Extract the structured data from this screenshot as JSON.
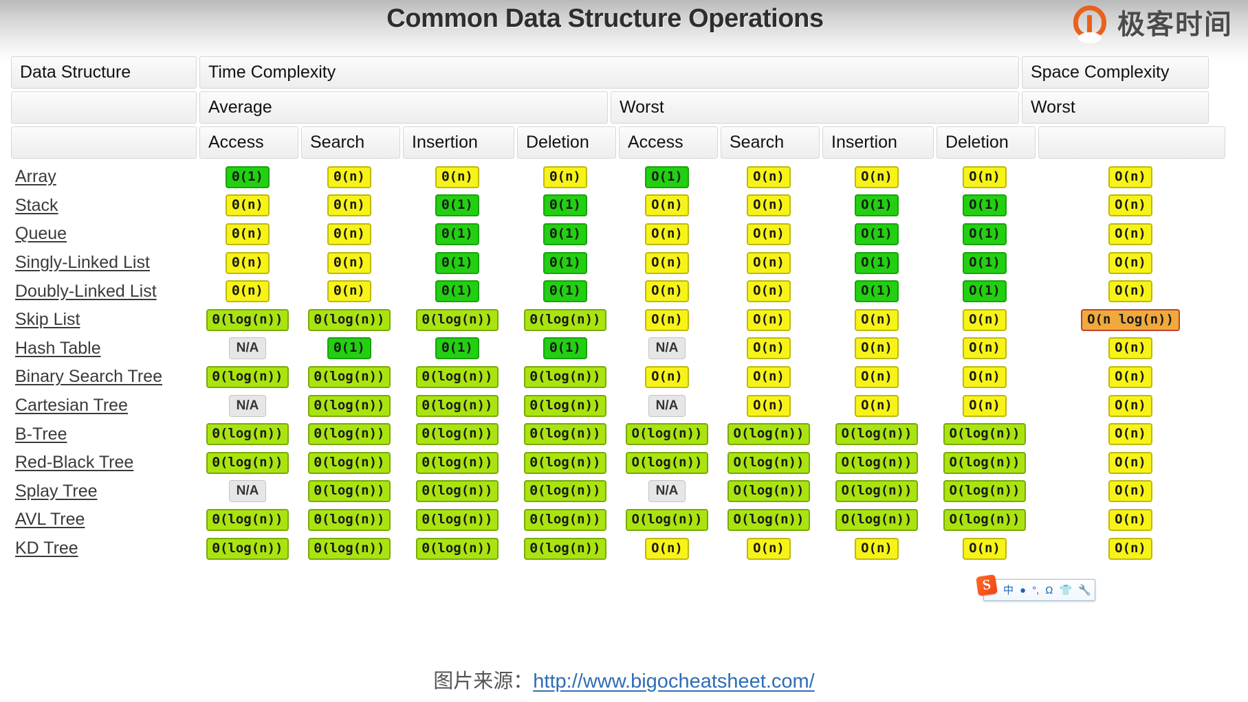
{
  "title": "Common Data Structure Operations",
  "brand": {
    "text": "极客时间",
    "mark": "geektime-logo-icon"
  },
  "table": {
    "header_row1": {
      "data_structure": "Data Structure",
      "time_complexity": "Time Complexity",
      "space_complexity": "Space Complexity"
    },
    "header_row2": {
      "average": "Average",
      "worst": "Worst",
      "space_worst": "Worst"
    },
    "header_row3": {
      "avg_access": "Access",
      "avg_search": "Search",
      "avg_insertion": "Insertion",
      "avg_deletion": "Deletion",
      "worst_access": "Access",
      "worst_search": "Search",
      "worst_insertion": "Insertion",
      "worst_deletion": "Deletion"
    },
    "rows": [
      {
        "name": "Array",
        "cells": [
          {
            "t": "Θ(1)",
            "c": "green"
          },
          {
            "t": "Θ(n)",
            "c": "yellow"
          },
          {
            "t": "Θ(n)",
            "c": "yellow"
          },
          {
            "t": "Θ(n)",
            "c": "yellow"
          },
          {
            "t": "O(1)",
            "c": "green"
          },
          {
            "t": "O(n)",
            "c": "yellow"
          },
          {
            "t": "O(n)",
            "c": "yellow"
          },
          {
            "t": "O(n)",
            "c": "yellow"
          },
          {
            "t": "O(n)",
            "c": "yellow"
          }
        ]
      },
      {
        "name": "Stack",
        "cells": [
          {
            "t": "Θ(n)",
            "c": "yellow"
          },
          {
            "t": "Θ(n)",
            "c": "yellow"
          },
          {
            "t": "Θ(1)",
            "c": "green"
          },
          {
            "t": "Θ(1)",
            "c": "green"
          },
          {
            "t": "O(n)",
            "c": "yellow"
          },
          {
            "t": "O(n)",
            "c": "yellow"
          },
          {
            "t": "O(1)",
            "c": "green"
          },
          {
            "t": "O(1)",
            "c": "green"
          },
          {
            "t": "O(n)",
            "c": "yellow"
          }
        ]
      },
      {
        "name": "Queue",
        "cells": [
          {
            "t": "Θ(n)",
            "c": "yellow"
          },
          {
            "t": "Θ(n)",
            "c": "yellow"
          },
          {
            "t": "Θ(1)",
            "c": "green"
          },
          {
            "t": "Θ(1)",
            "c": "green"
          },
          {
            "t": "O(n)",
            "c": "yellow"
          },
          {
            "t": "O(n)",
            "c": "yellow"
          },
          {
            "t": "O(1)",
            "c": "green"
          },
          {
            "t": "O(1)",
            "c": "green"
          },
          {
            "t": "O(n)",
            "c": "yellow"
          }
        ]
      },
      {
        "name": "Singly-Linked List",
        "cells": [
          {
            "t": "Θ(n)",
            "c": "yellow"
          },
          {
            "t": "Θ(n)",
            "c": "yellow"
          },
          {
            "t": "Θ(1)",
            "c": "green"
          },
          {
            "t": "Θ(1)",
            "c": "green"
          },
          {
            "t": "O(n)",
            "c": "yellow"
          },
          {
            "t": "O(n)",
            "c": "yellow"
          },
          {
            "t": "O(1)",
            "c": "green"
          },
          {
            "t": "O(1)",
            "c": "green"
          },
          {
            "t": "O(n)",
            "c": "yellow"
          }
        ]
      },
      {
        "name": "Doubly-Linked List",
        "cells": [
          {
            "t": "Θ(n)",
            "c": "yellow"
          },
          {
            "t": "Θ(n)",
            "c": "yellow"
          },
          {
            "t": "Θ(1)",
            "c": "green"
          },
          {
            "t": "Θ(1)",
            "c": "green"
          },
          {
            "t": "O(n)",
            "c": "yellow"
          },
          {
            "t": "O(n)",
            "c": "yellow"
          },
          {
            "t": "O(1)",
            "c": "green"
          },
          {
            "t": "O(1)",
            "c": "green"
          },
          {
            "t": "O(n)",
            "c": "yellow"
          }
        ]
      },
      {
        "name": "Skip List",
        "cells": [
          {
            "t": "Θ(log(n))",
            "c": "lime"
          },
          {
            "t": "Θ(log(n))",
            "c": "lime"
          },
          {
            "t": "Θ(log(n))",
            "c": "lime"
          },
          {
            "t": "Θ(log(n))",
            "c": "lime"
          },
          {
            "t": "O(n)",
            "c": "yellow"
          },
          {
            "t": "O(n)",
            "c": "yellow"
          },
          {
            "t": "O(n)",
            "c": "yellow"
          },
          {
            "t": "O(n)",
            "c": "yellow"
          },
          {
            "t": "O(n log(n))",
            "c": "orange"
          }
        ]
      },
      {
        "name": "Hash Table",
        "cells": [
          {
            "t": "N/A",
            "c": "na"
          },
          {
            "t": "Θ(1)",
            "c": "green"
          },
          {
            "t": "Θ(1)",
            "c": "green"
          },
          {
            "t": "Θ(1)",
            "c": "green"
          },
          {
            "t": "N/A",
            "c": "na"
          },
          {
            "t": "O(n)",
            "c": "yellow"
          },
          {
            "t": "O(n)",
            "c": "yellow"
          },
          {
            "t": "O(n)",
            "c": "yellow"
          },
          {
            "t": "O(n)",
            "c": "yellow"
          }
        ]
      },
      {
        "name": "Binary Search Tree",
        "cells": [
          {
            "t": "Θ(log(n))",
            "c": "lime"
          },
          {
            "t": "Θ(log(n))",
            "c": "lime"
          },
          {
            "t": "Θ(log(n))",
            "c": "lime"
          },
          {
            "t": "Θ(log(n))",
            "c": "lime"
          },
          {
            "t": "O(n)",
            "c": "yellow"
          },
          {
            "t": "O(n)",
            "c": "yellow"
          },
          {
            "t": "O(n)",
            "c": "yellow"
          },
          {
            "t": "O(n)",
            "c": "yellow"
          },
          {
            "t": "O(n)",
            "c": "yellow"
          }
        ]
      },
      {
        "name": "Cartesian Tree",
        "cells": [
          {
            "t": "N/A",
            "c": "na"
          },
          {
            "t": "Θ(log(n))",
            "c": "lime"
          },
          {
            "t": "Θ(log(n))",
            "c": "lime"
          },
          {
            "t": "Θ(log(n))",
            "c": "lime"
          },
          {
            "t": "N/A",
            "c": "na"
          },
          {
            "t": "O(n)",
            "c": "yellow"
          },
          {
            "t": "O(n)",
            "c": "yellow"
          },
          {
            "t": "O(n)",
            "c": "yellow"
          },
          {
            "t": "O(n)",
            "c": "yellow"
          }
        ]
      },
      {
        "name": "B-Tree",
        "cells": [
          {
            "t": "Θ(log(n))",
            "c": "lime"
          },
          {
            "t": "Θ(log(n))",
            "c": "lime"
          },
          {
            "t": "Θ(log(n))",
            "c": "lime"
          },
          {
            "t": "Θ(log(n))",
            "c": "lime"
          },
          {
            "t": "O(log(n))",
            "c": "lime"
          },
          {
            "t": "O(log(n))",
            "c": "lime"
          },
          {
            "t": "O(log(n))",
            "c": "lime"
          },
          {
            "t": "O(log(n))",
            "c": "lime"
          },
          {
            "t": "O(n)",
            "c": "yellow"
          }
        ]
      },
      {
        "name": "Red-Black Tree",
        "cells": [
          {
            "t": "Θ(log(n))",
            "c": "lime"
          },
          {
            "t": "Θ(log(n))",
            "c": "lime"
          },
          {
            "t": "Θ(log(n))",
            "c": "lime"
          },
          {
            "t": "Θ(log(n))",
            "c": "lime"
          },
          {
            "t": "O(log(n))",
            "c": "lime"
          },
          {
            "t": "O(log(n))",
            "c": "lime"
          },
          {
            "t": "O(log(n))",
            "c": "lime"
          },
          {
            "t": "O(log(n))",
            "c": "lime"
          },
          {
            "t": "O(n)",
            "c": "yellow"
          }
        ]
      },
      {
        "name": "Splay Tree",
        "cells": [
          {
            "t": "N/A",
            "c": "na"
          },
          {
            "t": "Θ(log(n))",
            "c": "lime"
          },
          {
            "t": "Θ(log(n))",
            "c": "lime"
          },
          {
            "t": "Θ(log(n))",
            "c": "lime"
          },
          {
            "t": "N/A",
            "c": "na"
          },
          {
            "t": "O(log(n))",
            "c": "lime"
          },
          {
            "t": "O(log(n))",
            "c": "lime"
          },
          {
            "t": "O(log(n))",
            "c": "lime"
          },
          {
            "t": "O(n)",
            "c": "yellow"
          }
        ]
      },
      {
        "name": "AVL Tree",
        "cells": [
          {
            "t": "Θ(log(n))",
            "c": "lime"
          },
          {
            "t": "Θ(log(n))",
            "c": "lime"
          },
          {
            "t": "Θ(log(n))",
            "c": "lime"
          },
          {
            "t": "Θ(log(n))",
            "c": "lime"
          },
          {
            "t": "O(log(n))",
            "c": "lime"
          },
          {
            "t": "O(log(n))",
            "c": "lime"
          },
          {
            "t": "O(log(n))",
            "c": "lime"
          },
          {
            "t": "O(log(n))",
            "c": "lime"
          },
          {
            "t": "O(n)",
            "c": "yellow"
          }
        ]
      },
      {
        "name": "KD Tree",
        "cells": [
          {
            "t": "Θ(log(n))",
            "c": "lime"
          },
          {
            "t": "Θ(log(n))",
            "c": "lime"
          },
          {
            "t": "Θ(log(n))",
            "c": "lime"
          },
          {
            "t": "Θ(log(n))",
            "c": "lime"
          },
          {
            "t": "O(n)",
            "c": "yellow"
          },
          {
            "t": "O(n)",
            "c": "yellow"
          },
          {
            "t": "O(n)",
            "c": "yellow"
          },
          {
            "t": "O(n)",
            "c": "yellow"
          },
          {
            "t": "O(n)",
            "c": "yellow"
          }
        ]
      }
    ]
  },
  "footer": {
    "source_label": "图片来源：",
    "source_url": "http://www.bigocheatsheet.com/"
  },
  "ime_bar": {
    "logo": "S",
    "items": [
      "中",
      "●",
      "°,",
      "Ω",
      "👕",
      "🔧"
    ]
  },
  "colors": {
    "green": "#22d011",
    "lime": "#aae410",
    "yellow": "#f7f318",
    "orange": "#f0a93c",
    "na_gray": "#e6e6e6",
    "link_blue": "#2f6cb5",
    "brand_orange": "#e8611d"
  }
}
